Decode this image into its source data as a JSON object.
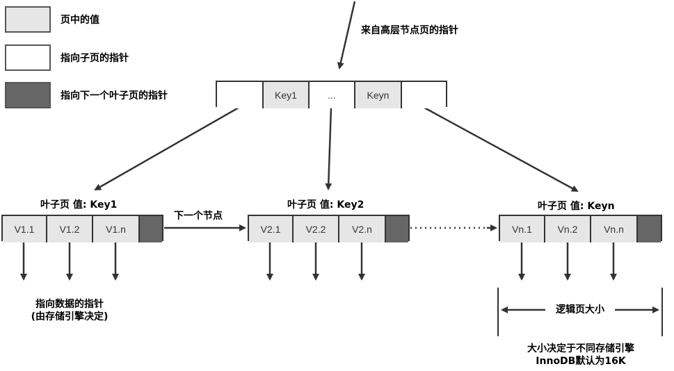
{
  "legend": {
    "value_label": "页中的值",
    "child_pointer_label": "指向子页的指针",
    "next_leaf_pointer_label": "指向下一个叶子页的指针"
  },
  "root": {
    "incoming_label": "来自高层节点页的指针",
    "cells": [
      "",
      "Key1",
      "...",
      "Keyn",
      ""
    ]
  },
  "leaves": [
    {
      "title": "叶子页 值: Key1",
      "values": [
        "V1.1",
        "V1.2",
        "V1.n"
      ]
    },
    {
      "title": "叶子页 值: Key2",
      "values": [
        "V2.1",
        "V2.2",
        "V2.n"
      ]
    },
    {
      "title": "叶子页 值: Keyn",
      "values": [
        "Vn.1",
        "Vn.2",
        "Vn.n"
      ]
    }
  ],
  "next_node_label": "下一个节点",
  "data_pointer_label": [
    "指向数据的指针",
    "(由存储引擎决定)"
  ],
  "page_size_label": "逻辑页大小",
  "page_size_note": [
    "大小决定于不同存储引擎",
    "InnoDB默认为16K"
  ],
  "colors": {
    "value_fill": "#e6e6e6",
    "pointer_fill": "#ffffff",
    "next_pointer_fill": "#666666",
    "stroke": "#333333"
  }
}
